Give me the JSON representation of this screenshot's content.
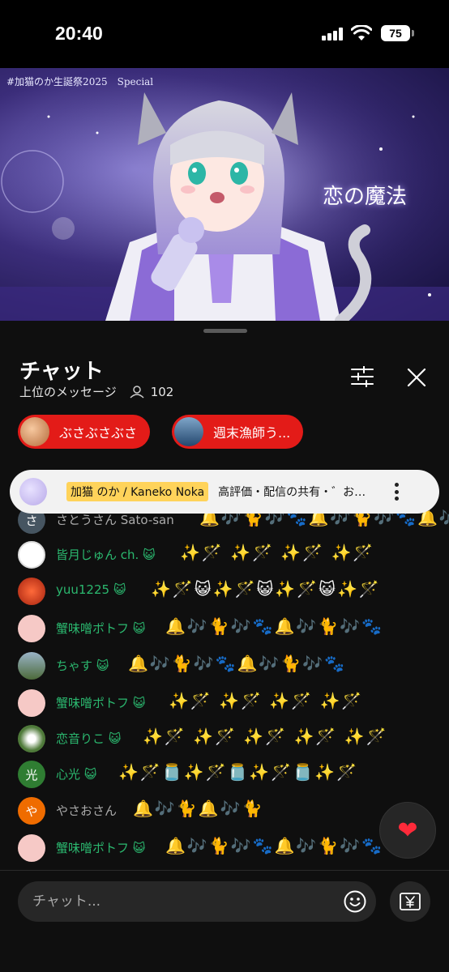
{
  "status": {
    "time": "20:40",
    "battery": "75"
  },
  "video": {
    "title_overlay": "#加猫のか生誕祭2025　Special",
    "song_title": "恋の魔法"
  },
  "chat": {
    "title": "チャット",
    "mode": "上位のメッセージ",
    "viewers": "102",
    "input_placeholder": "チャット..."
  },
  "donors": [
    {
      "name": "ぶさぶさぶさ"
    },
    {
      "name": "週末漁師う..."
    }
  ],
  "pinned": {
    "author": "加猫 のか / Kaneko Noka",
    "message": "高評価・配信の共有・゛お…"
  },
  "messages": [
    {
      "name": "さとうさん Sato-san",
      "initial": "さ",
      "emojis": "🔔🎶🐈🎶🐾🔔🎶🐈🎶🐾🔔🎶"
    },
    {
      "name": "皆月じゅん ch. 😺",
      "initial": "",
      "emojis": "✨🪄 ✨🪄 ✨🪄 ✨🪄"
    },
    {
      "name": "yuu1225 😺",
      "initial": "",
      "emojis": "✨🪄😺✨🪄😺✨🪄😺✨🪄"
    },
    {
      "name": "蟹味噌ポトフ 😺",
      "initial": "",
      "emojis": "🔔🎶🐈🎶🐾🔔🎶🐈🎶🐾"
    },
    {
      "name": "ちゃす 😺",
      "initial": "",
      "emojis": "🔔🎶🐈🎶🐾🔔🎶🐈🎶🐾"
    },
    {
      "name": "蟹味噌ポトフ 😺",
      "initial": "",
      "emojis": "✨🪄 ✨🪄 ✨🪄 ✨🪄"
    },
    {
      "name": "恋音りこ 😺",
      "initial": "",
      "emojis": "✨🪄 ✨🪄 ✨🪄 ✨🪄 ✨🪄"
    },
    {
      "name": "心光 😺",
      "initial": "光",
      "emojis": "✨🪄🫙✨🪄🫙✨🪄🫙✨🪄"
    },
    {
      "name": "やさおさん",
      "initial": "や",
      "emojis": "🔔🎶🐈🔔🎶🐈"
    },
    {
      "name": "蟹味噌ポトフ 😺",
      "initial": "",
      "emojis": "🔔🎶🐈🎶🐾🔔🎶🐈🎶🐾"
    }
  ],
  "colors": {
    "accent_red": "#e31b18",
    "name_green": "#2bb86f",
    "heart": "#ff2a3a"
  },
  "icons": [
    "filter-icon",
    "close-icon",
    "emoji-icon",
    "yen-icon",
    "heart-icon",
    "more-vert-icon"
  ]
}
